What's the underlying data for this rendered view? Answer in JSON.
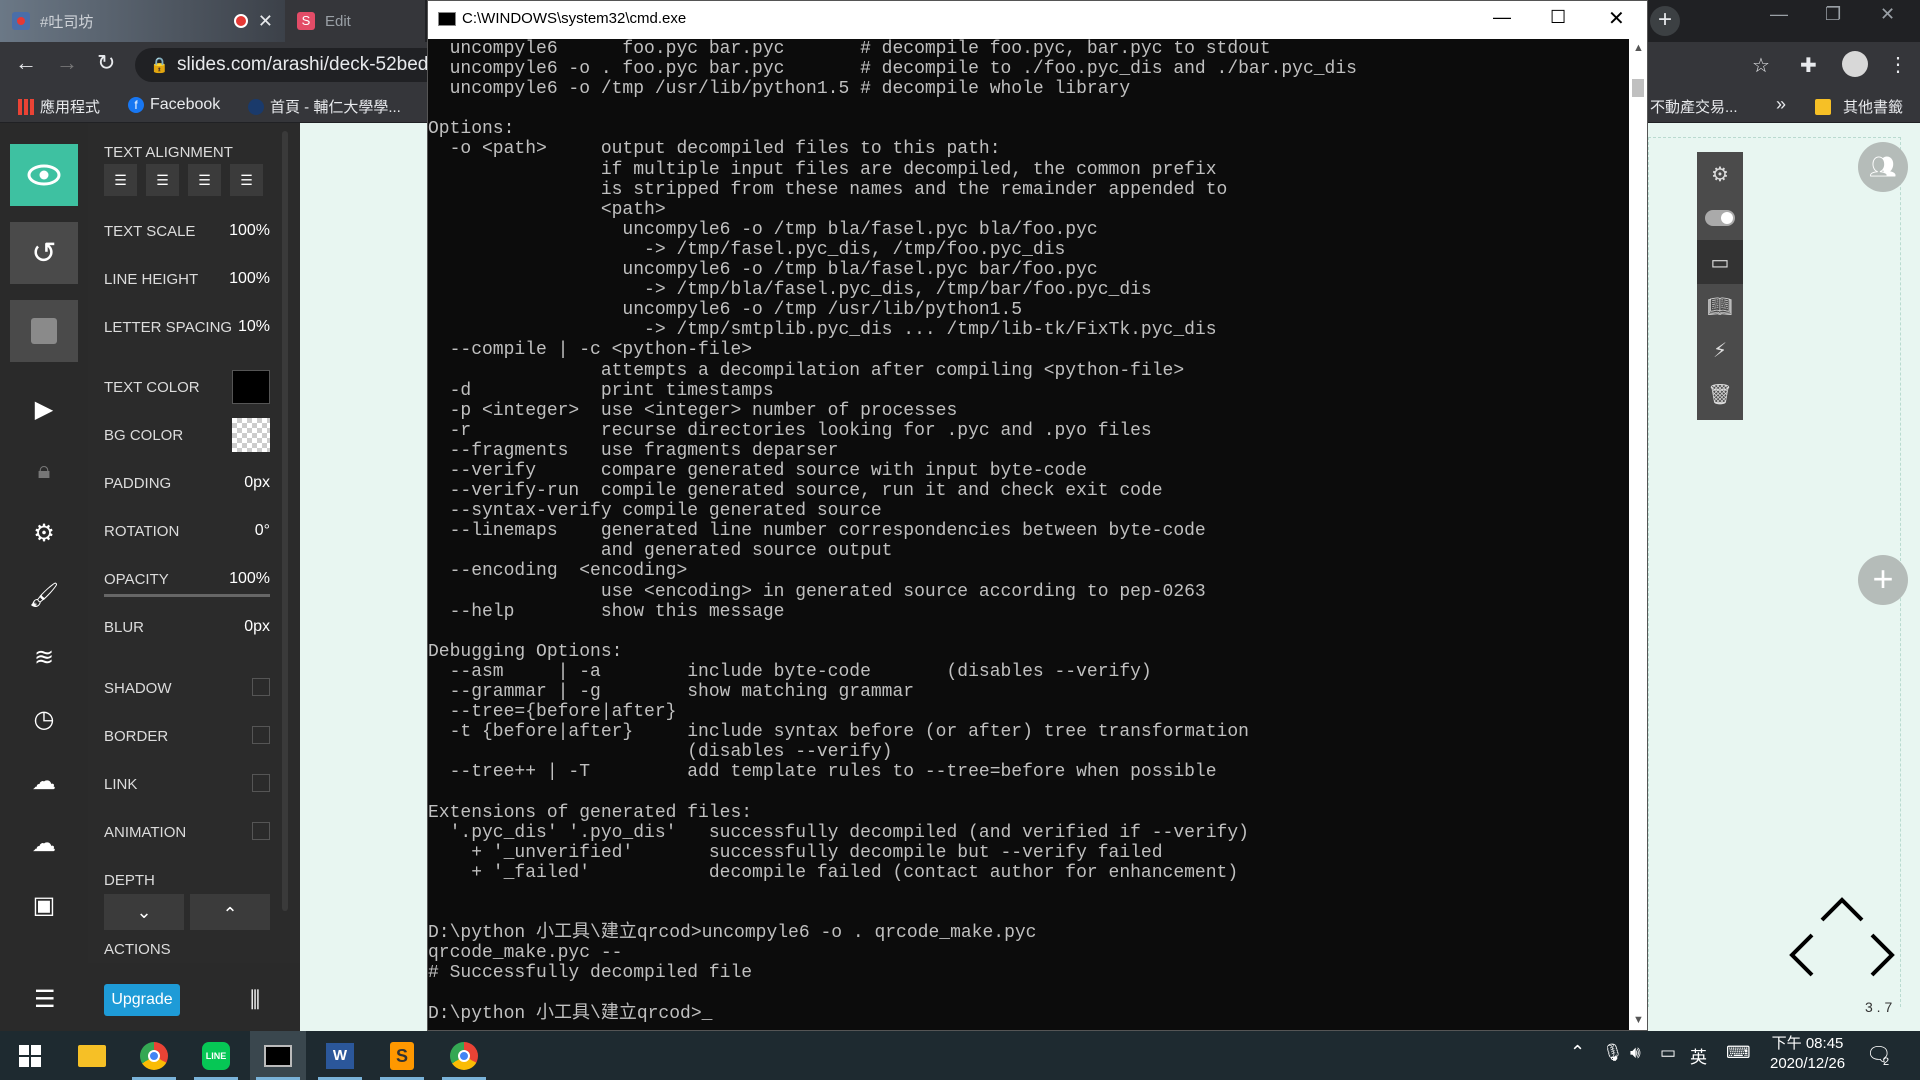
{
  "browser": {
    "tabs": [
      {
        "label": "#吐司坊",
        "icon": "recording-icon"
      },
      {
        "label": "Edit",
        "icon": "slides-icon"
      }
    ],
    "url": "slides.com/arashi/deck-52bed",
    "bookmarks": [
      {
        "label": "應用程式",
        "icon": "apps-grid-icon"
      },
      {
        "label": "Facebook",
        "icon": "facebook-icon"
      },
      {
        "label": "首頁 - 輔仁大學學...",
        "icon": "globe-icon"
      },
      {
        "label": "不動產交易...",
        "icon": "bookmark-icon"
      },
      {
        "label": "其他書籤",
        "icon": "folder-icon"
      }
    ],
    "more_bookmarks": "»"
  },
  "editor": {
    "section_title": "TEXT ALIGNMENT",
    "props": [
      {
        "label": "TEXT SCALE",
        "value": "100%"
      },
      {
        "label": "LINE HEIGHT",
        "value": "100%"
      },
      {
        "label": "LETTER SPACING",
        "value": "10%"
      },
      {
        "label": "TEXT COLOR",
        "value": ""
      },
      {
        "label": "BG COLOR",
        "value": ""
      },
      {
        "label": "PADDING",
        "value": "0px"
      },
      {
        "label": "ROTATION",
        "value": "0°"
      },
      {
        "label": "OPACITY",
        "value": "100%"
      },
      {
        "label": "BLUR",
        "value": "0px"
      }
    ],
    "checks": [
      "SHADOW",
      "BORDER",
      "LINK",
      "ANIMATION"
    ],
    "depth_label": "DEPTH",
    "actions_label": "ACTIONS",
    "upgrade_label": "Upgrade",
    "text_color": "#000000",
    "accent": "#3ec1a1"
  },
  "slide_nav": {
    "indicator": "3 . 7"
  },
  "cmd": {
    "title": "C:\\WINDOWS\\system32\\cmd.exe",
    "lines": [
      "  uncompyle6      foo.pyc bar.pyc       # decompile foo.pyc, bar.pyc to stdout",
      "  uncompyle6 -o . foo.pyc bar.pyc       # decompile to ./foo.pyc_dis and ./bar.pyc_dis",
      "  uncompyle6 -o /tmp /usr/lib/python1.5 # decompile whole library",
      "",
      "Options:",
      "  -o <path>     output decompiled files to this path:",
      "                if multiple input files are decompiled, the common prefix",
      "                is stripped from these names and the remainder appended to",
      "                <path>",
      "                  uncompyle6 -o /tmp bla/fasel.pyc bla/foo.pyc",
      "                    -> /tmp/fasel.pyc_dis, /tmp/foo.pyc_dis",
      "                  uncompyle6 -o /tmp bla/fasel.pyc bar/foo.pyc",
      "                    -> /tmp/bla/fasel.pyc_dis, /tmp/bar/foo.pyc_dis",
      "                  uncompyle6 -o /tmp /usr/lib/python1.5",
      "                    -> /tmp/smtplib.pyc_dis ... /tmp/lib-tk/FixTk.pyc_dis",
      "  --compile | -c <python-file>",
      "                attempts a decompilation after compiling <python-file>",
      "  -d            print timestamps",
      "  -p <integer>  use <integer> number of processes",
      "  -r            recurse directories looking for .pyc and .pyo files",
      "  --fragments   use fragments deparser",
      "  --verify      compare generated source with input byte-code",
      "  --verify-run  compile generated source, run it and check exit code",
      "  --syntax-verify compile generated source",
      "  --linemaps    generated line number correspondencies between byte-code",
      "                and generated source output",
      "  --encoding  <encoding>",
      "                use <encoding> in generated source according to pep-0263",
      "  --help        show this message",
      "",
      "Debugging Options:",
      "  --asm     | -a        include byte-code       (disables --verify)",
      "  --grammar | -g        show matching grammar",
      "  --tree={before|after}",
      "  -t {before|after}     include syntax before (or after) tree transformation",
      "                        (disables --verify)",
      "  --tree++ | -T         add template rules to --tree=before when possible",
      "",
      "Extensions of generated files:",
      "  '.pyc_dis' '.pyo_dis'   successfully decompiled (and verified if --verify)",
      "    + '_unverified'       successfully decompile but --verify failed",
      "    + '_failed'           decompile failed (contact author for enhancement)",
      "",
      "",
      "D:\\python 小工具\\建立qrcod>uncompyle6 -o . qrcode_make.pyc",
      "qrcode_make.pyc --",
      "# Successfully decompiled file",
      "",
      "D:\\python 小工具\\建立qrcod>_"
    ]
  },
  "taskbar": {
    "apps": [
      "windows-start-icon",
      "file-explorer-icon",
      "chrome-icon",
      "line-icon",
      "cmd-icon",
      "word-icon",
      "sublime-icon",
      "chrome-icon"
    ],
    "time": "下午 08:45",
    "date": "2020/12/26",
    "ime": "英",
    "notifications": "2"
  }
}
